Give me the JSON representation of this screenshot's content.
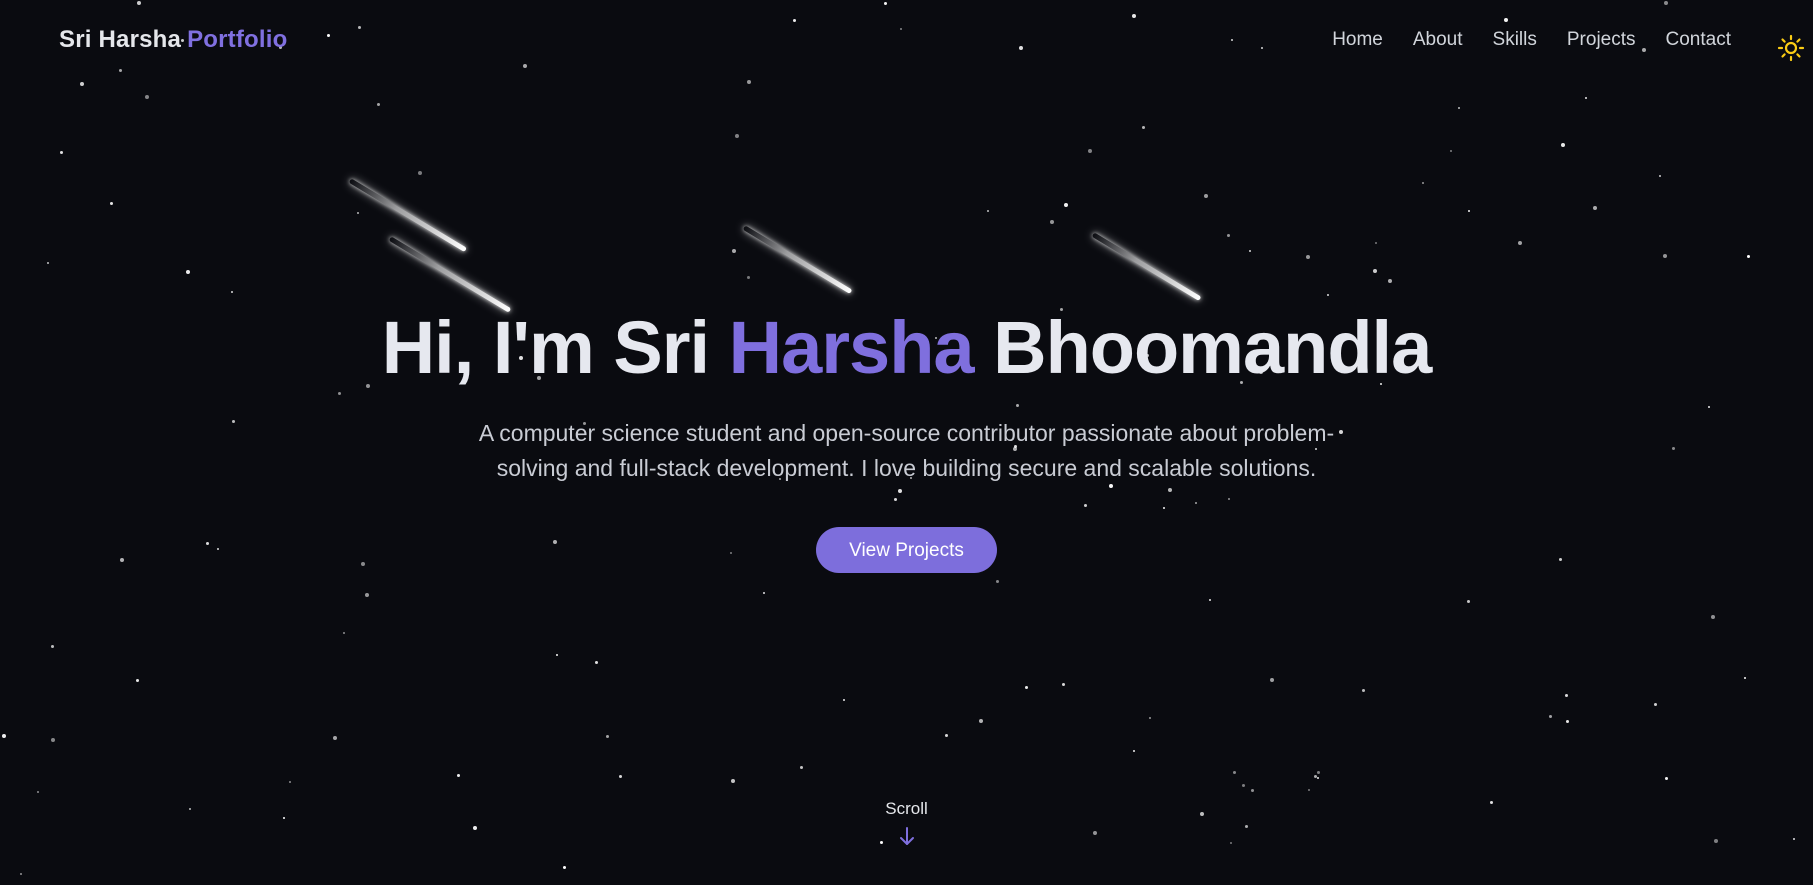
{
  "header": {
    "brand_name": "Sri Harsha",
    "brand_accent": "Portfolio",
    "nav": [
      {
        "label": "Home"
      },
      {
        "label": "About"
      },
      {
        "label": "Skills"
      },
      {
        "label": "Projects"
      },
      {
        "label": "Contact"
      }
    ],
    "theme_icon": "sun-icon"
  },
  "hero": {
    "greeting": "Hi, I'm Sri",
    "name_highlight": "Harsha",
    "name_rest": "Bhoomandla",
    "tagline": "A computer science student and open-source contributor passionate about problem-solving and full-stack development. I love building secure and scalable solutions.",
    "cta_label": "View Projects"
  },
  "scroll": {
    "label": "Scroll",
    "icon": "arrow-down-icon"
  },
  "colors": {
    "background": "#0a0b10",
    "accent": "#7f6fde",
    "text": "#e6e8ef",
    "sun": "#facc15"
  }
}
